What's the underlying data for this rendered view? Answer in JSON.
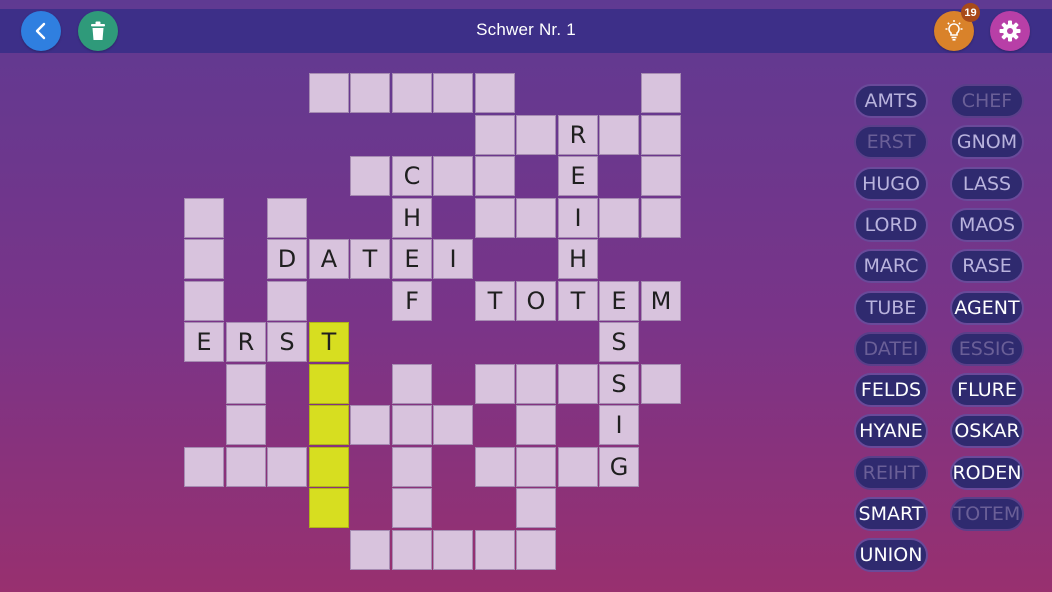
{
  "header": {
    "title": "Schwer Nr. 1",
    "hint_count": "19"
  },
  "colors": {
    "cell": "#d8c3dd",
    "highlight": "#d7de20",
    "back": "#2f7fe0",
    "trash": "#2f9a7a",
    "hint": "#d9822a",
    "settings": "#b83fa7"
  },
  "icons": {
    "back": "chevron-left-icon",
    "trash": "trash-icon",
    "hint": "lightbulb-icon",
    "settings": "gear-icon"
  },
  "grid": {
    "cells": [
      {
        "r": 0,
        "c": 3,
        "l": "",
        "hl": false
      },
      {
        "r": 0,
        "c": 4,
        "l": "",
        "hl": false
      },
      {
        "r": 0,
        "c": 5,
        "l": "",
        "hl": false
      },
      {
        "r": 0,
        "c": 6,
        "l": "",
        "hl": false
      },
      {
        "r": 0,
        "c": 7,
        "l": "",
        "hl": false
      },
      {
        "r": 0,
        "c": 11,
        "l": "",
        "hl": false
      },
      {
        "r": 1,
        "c": 7,
        "l": "",
        "hl": false
      },
      {
        "r": 1,
        "c": 8,
        "l": "",
        "hl": false
      },
      {
        "r": 1,
        "c": 9,
        "l": "R",
        "hl": false
      },
      {
        "r": 1,
        "c": 10,
        "l": "",
        "hl": false
      },
      {
        "r": 1,
        "c": 11,
        "l": "",
        "hl": false
      },
      {
        "r": 2,
        "c": 4,
        "l": "",
        "hl": false
      },
      {
        "r": 2,
        "c": 5,
        "l": "C",
        "hl": false
      },
      {
        "r": 2,
        "c": 6,
        "l": "",
        "hl": false
      },
      {
        "r": 2,
        "c": 7,
        "l": "",
        "hl": false
      },
      {
        "r": 2,
        "c": 9,
        "l": "E",
        "hl": false
      },
      {
        "r": 2,
        "c": 11,
        "l": "",
        "hl": false
      },
      {
        "r": 3,
        "c": 0,
        "l": "",
        "hl": false
      },
      {
        "r": 3,
        "c": 2,
        "l": "",
        "hl": false
      },
      {
        "r": 3,
        "c": 5,
        "l": "H",
        "hl": false
      },
      {
        "r": 3,
        "c": 7,
        "l": "",
        "hl": false
      },
      {
        "r": 3,
        "c": 8,
        "l": "",
        "hl": false
      },
      {
        "r": 3,
        "c": 9,
        "l": "I",
        "hl": false
      },
      {
        "r": 3,
        "c": 10,
        "l": "",
        "hl": false
      },
      {
        "r": 3,
        "c": 11,
        "l": "",
        "hl": false
      },
      {
        "r": 4,
        "c": 0,
        "l": "",
        "hl": false
      },
      {
        "r": 4,
        "c": 2,
        "l": "D",
        "hl": false
      },
      {
        "r": 4,
        "c": 3,
        "l": "A",
        "hl": false
      },
      {
        "r": 4,
        "c": 4,
        "l": "T",
        "hl": false
      },
      {
        "r": 4,
        "c": 5,
        "l": "E",
        "hl": false
      },
      {
        "r": 4,
        "c": 6,
        "l": "I",
        "hl": false
      },
      {
        "r": 4,
        "c": 9,
        "l": "H",
        "hl": false
      },
      {
        "r": 5,
        "c": 0,
        "l": "",
        "hl": false
      },
      {
        "r": 5,
        "c": 2,
        "l": "",
        "hl": false
      },
      {
        "r": 5,
        "c": 5,
        "l": "F",
        "hl": false
      },
      {
        "r": 5,
        "c": 7,
        "l": "T",
        "hl": false
      },
      {
        "r": 5,
        "c": 8,
        "l": "O",
        "hl": false
      },
      {
        "r": 5,
        "c": 9,
        "l": "T",
        "hl": false
      },
      {
        "r": 5,
        "c": 10,
        "l": "E",
        "hl": false
      },
      {
        "r": 5,
        "c": 11,
        "l": "M",
        "hl": false
      },
      {
        "r": 6,
        "c": 0,
        "l": "E",
        "hl": false
      },
      {
        "r": 6,
        "c": 1,
        "l": "R",
        "hl": false
      },
      {
        "r": 6,
        "c": 2,
        "l": "S",
        "hl": false
      },
      {
        "r": 6,
        "c": 3,
        "l": "T",
        "hl": true
      },
      {
        "r": 6,
        "c": 10,
        "l": "S",
        "hl": false
      },
      {
        "r": 7,
        "c": 1,
        "l": "",
        "hl": false
      },
      {
        "r": 7,
        "c": 3,
        "l": "",
        "hl": true
      },
      {
        "r": 7,
        "c": 5,
        "l": "",
        "hl": false
      },
      {
        "r": 7,
        "c": 7,
        "l": "",
        "hl": false
      },
      {
        "r": 7,
        "c": 8,
        "l": "",
        "hl": false
      },
      {
        "r": 7,
        "c": 9,
        "l": "",
        "hl": false
      },
      {
        "r": 7,
        "c": 10,
        "l": "S",
        "hl": false
      },
      {
        "r": 7,
        "c": 11,
        "l": "",
        "hl": false
      },
      {
        "r": 8,
        "c": 1,
        "l": "",
        "hl": false
      },
      {
        "r": 8,
        "c": 3,
        "l": "",
        "hl": true
      },
      {
        "r": 8,
        "c": 4,
        "l": "",
        "hl": false
      },
      {
        "r": 8,
        "c": 5,
        "l": "",
        "hl": false
      },
      {
        "r": 8,
        "c": 6,
        "l": "",
        "hl": false
      },
      {
        "r": 8,
        "c": 8,
        "l": "",
        "hl": false
      },
      {
        "r": 8,
        "c": 10,
        "l": "I",
        "hl": false
      },
      {
        "r": 9,
        "c": 0,
        "l": "",
        "hl": false
      },
      {
        "r": 9,
        "c": 1,
        "l": "",
        "hl": false
      },
      {
        "r": 9,
        "c": 2,
        "l": "",
        "hl": false
      },
      {
        "r": 9,
        "c": 3,
        "l": "",
        "hl": true
      },
      {
        "r": 9,
        "c": 5,
        "l": "",
        "hl": false
      },
      {
        "r": 9,
        "c": 7,
        "l": "",
        "hl": false
      },
      {
        "r": 9,
        "c": 8,
        "l": "",
        "hl": false
      },
      {
        "r": 9,
        "c": 9,
        "l": "",
        "hl": false
      },
      {
        "r": 9,
        "c": 10,
        "l": "G",
        "hl": false
      },
      {
        "r": 10,
        "c": 3,
        "l": "",
        "hl": true
      },
      {
        "r": 10,
        "c": 5,
        "l": "",
        "hl": false
      },
      {
        "r": 10,
        "c": 8,
        "l": "",
        "hl": false
      },
      {
        "r": 11,
        "c": 4,
        "l": "",
        "hl": false
      },
      {
        "r": 11,
        "c": 5,
        "l": "",
        "hl": false
      },
      {
        "r": 11,
        "c": 6,
        "l": "",
        "hl": false
      },
      {
        "r": 11,
        "c": 7,
        "l": "",
        "hl": false
      },
      {
        "r": 11,
        "c": 8,
        "l": "",
        "hl": false
      }
    ]
  },
  "words": [
    {
      "text": "AMTS",
      "state": "normal"
    },
    {
      "text": "CHEF",
      "state": "used"
    },
    {
      "text": "ERST",
      "state": "used"
    },
    {
      "text": "GNOM",
      "state": "normal"
    },
    {
      "text": "HUGO",
      "state": "normal"
    },
    {
      "text": "LASS",
      "state": "normal"
    },
    {
      "text": "LORD",
      "state": "normal"
    },
    {
      "text": "MAOS",
      "state": "normal"
    },
    {
      "text": "MARC",
      "state": "normal"
    },
    {
      "text": "RASE",
      "state": "normal"
    },
    {
      "text": "TUBE",
      "state": "normal"
    },
    {
      "text": "AGENT",
      "state": "bright"
    },
    {
      "text": "DATEI",
      "state": "used"
    },
    {
      "text": "ESSIG",
      "state": "used"
    },
    {
      "text": "FELDS",
      "state": "bright"
    },
    {
      "text": "FLURE",
      "state": "bright"
    },
    {
      "text": "HYANE",
      "state": "bright"
    },
    {
      "text": "OSKAR",
      "state": "bright"
    },
    {
      "text": "REIHT",
      "state": "used"
    },
    {
      "text": "RODEN",
      "state": "bright"
    },
    {
      "text": "SMART",
      "state": "bright"
    },
    {
      "text": "TOTEM",
      "state": "used"
    },
    {
      "text": "UNION",
      "state": "bright"
    }
  ]
}
